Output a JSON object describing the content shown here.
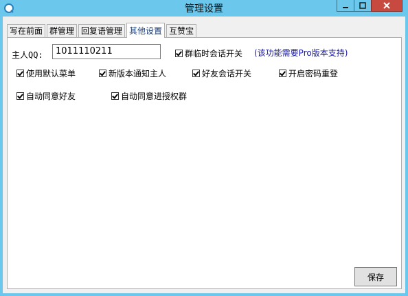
{
  "window": {
    "title": "管理设置",
    "accent_color": "#6bc8ec",
    "close_color": "#c7493f"
  },
  "tabs": [
    {
      "label": "写在前面",
      "active": false
    },
    {
      "label": "群管理",
      "active": false
    },
    {
      "label": "回复语管理",
      "active": false
    },
    {
      "label": "其他设置",
      "active": true
    },
    {
      "label": "互赞宝",
      "active": false
    }
  ],
  "form": {
    "qq_label": "主人QQ:",
    "qq_value": "1011110211",
    "note": "(该功能需要Pro版本支持)"
  },
  "checkboxes": {
    "group_temp_chat": {
      "label": "群临时会话开关",
      "checked": true
    },
    "default_menu": {
      "label": "使用默认菜单",
      "checked": true
    },
    "new_version_notify": {
      "label": "新版本通知主人",
      "checked": true
    },
    "friend_chat": {
      "label": "好友会话开关",
      "checked": true
    },
    "password_reset": {
      "label": "开启密码重登",
      "checked": true
    },
    "auto_accept_friend": {
      "label": "自动同意好友",
      "checked": true
    },
    "auto_accept_group": {
      "label": "自动同意进授权群",
      "checked": true
    }
  },
  "buttons": {
    "save": "保存"
  }
}
